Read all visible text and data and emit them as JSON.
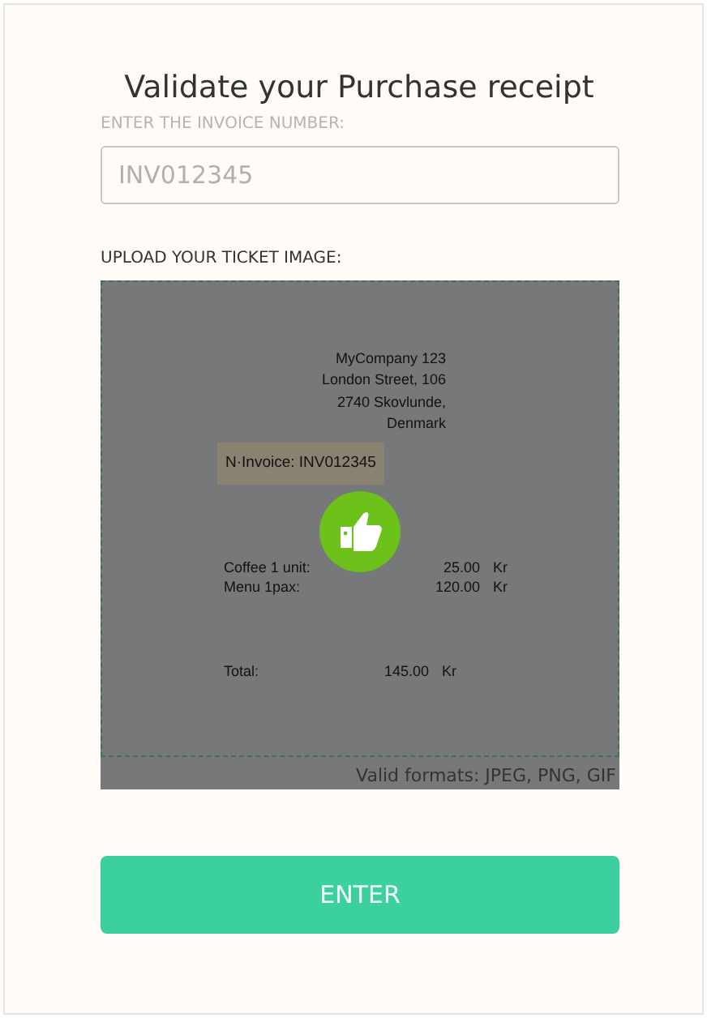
{
  "title": "Validate your Purchase receipt",
  "invoice": {
    "label": "ENTER THE INVOICE NUMBER:",
    "placeholder": "INV012345"
  },
  "upload": {
    "label": "UPLOAD YOUR TICKET IMAGE:",
    "receipt": {
      "address": [
        "MyCompany 123",
        "London Street, 106",
        "2740 Skovlunde,",
        "Denmark"
      ],
      "invoice": "N·Invoice: INV012345",
      "items": [
        {
          "name": "Coffee 1 unit:",
          "amount": "25.00",
          "currency": "Kr"
        },
        {
          "name": "Menu 1pax:",
          "amount": "120.00",
          "currency": "Kr"
        }
      ],
      "total": {
        "label": "Total:",
        "amount": "145.00",
        "currency": "Kr"
      }
    },
    "hint": "Valid formats: JPEG, PNG, GIF"
  },
  "submit": "ENTER"
}
